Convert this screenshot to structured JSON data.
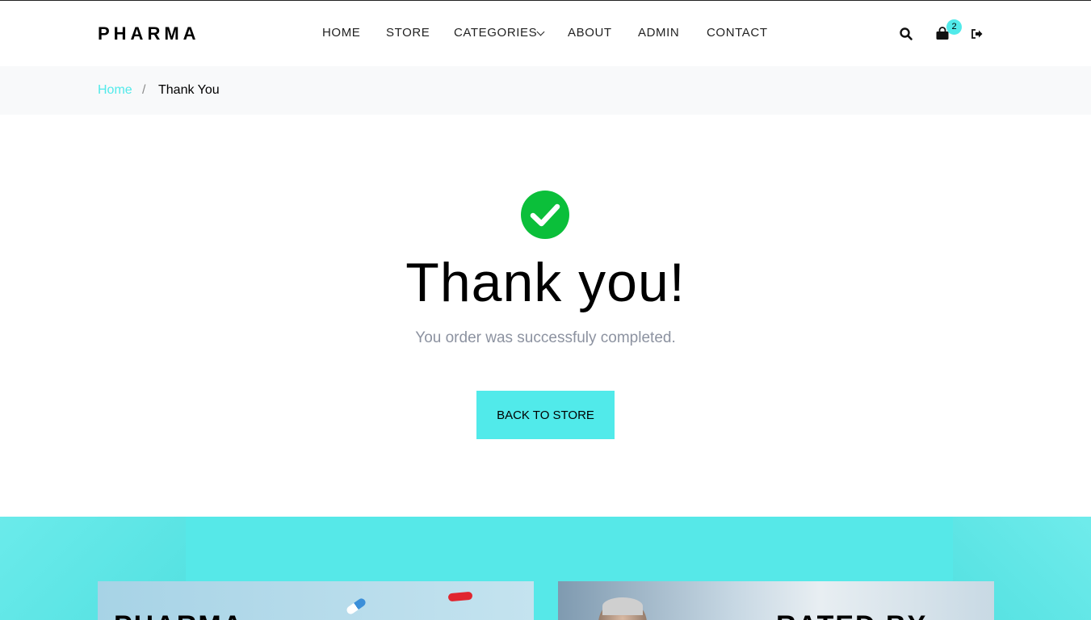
{
  "brand": {
    "logo": "PHARMA"
  },
  "nav": {
    "items": [
      {
        "label": "HOME"
      },
      {
        "label": "STORE"
      },
      {
        "label": "CATEGORIES"
      },
      {
        "label": "ABOUT"
      },
      {
        "label": "ADMIN"
      },
      {
        "label": "CONTACT"
      }
    ]
  },
  "header_icons": {
    "search": "search-icon",
    "cart": "shopping-bag-icon",
    "logout": "sign-out-icon",
    "cart_count": "2"
  },
  "breadcrumb": {
    "home": "Home",
    "separator": "/",
    "current": "Thank You"
  },
  "confirmation": {
    "icon": "check-circle-icon",
    "title": "Thank you!",
    "message": "You order was successfuly completed.",
    "button_label": "BACK TO STORE"
  },
  "promo": {
    "cards": [
      {
        "title": "PHARMA"
      },
      {
        "title": "RATED BY"
      }
    ]
  },
  "colors": {
    "accent": "#51eaea",
    "success": "#0bbf3a",
    "muted_text": "#8c92a0",
    "crumb_bg": "#f8f9fa"
  }
}
